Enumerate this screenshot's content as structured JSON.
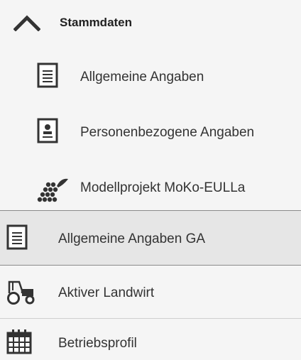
{
  "nav": {
    "section": {
      "label": "Stammdaten",
      "icon": "chevron-up-icon",
      "expanded": true
    },
    "sub_items": [
      {
        "label": "Allgemeine Angaben",
        "icon": "document-icon"
      },
      {
        "label": "Personenbezogene Angaben",
        "icon": "person-card-icon"
      },
      {
        "label": "Modellprojekt MoKo-EULLa",
        "icon": "grapes-icon"
      }
    ],
    "items": [
      {
        "label": "Allgemeine Angaben GA",
        "icon": "document-icon",
        "active": true
      },
      {
        "label": "Aktiver Landwirt",
        "icon": "tractor-icon"
      },
      {
        "label": "Betriebsprofil",
        "icon": "calendar-icon"
      }
    ]
  },
  "colors": {
    "background": "#f5f5f5",
    "active_background": "#e6e6e6",
    "icon": "#333333"
  }
}
